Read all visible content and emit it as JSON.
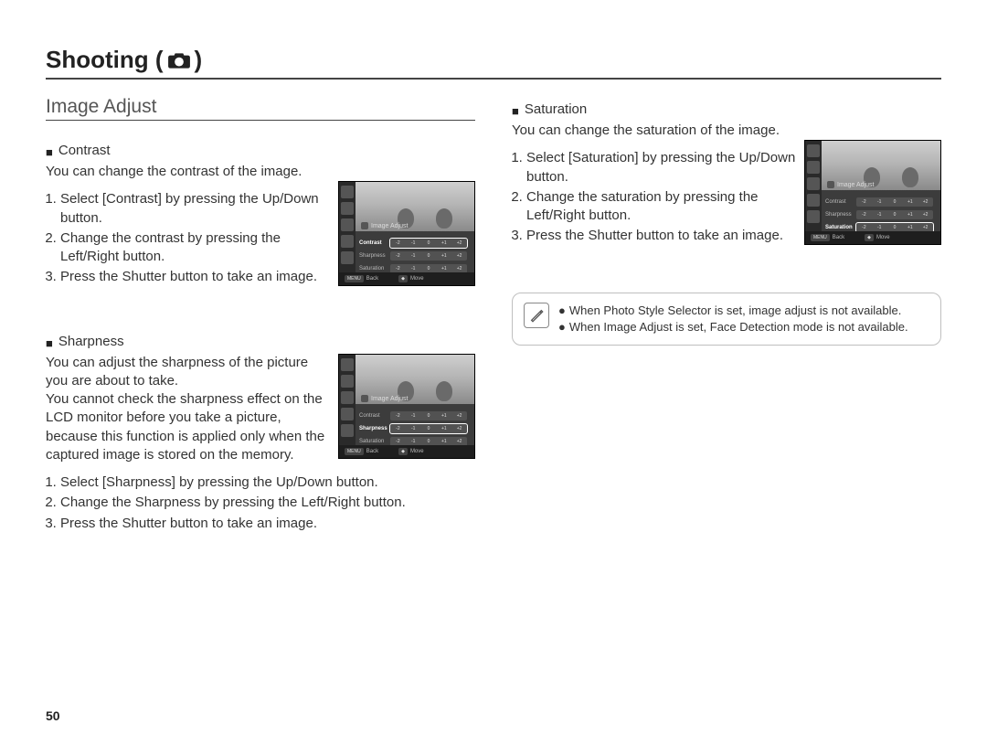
{
  "title": {
    "prefix": "Shooting (",
    "suffix": " )"
  },
  "section_title": "Image Adjust",
  "page_number": "50",
  "tick_labels": [
    "-2",
    "-1",
    "0",
    "+1",
    "+2"
  ],
  "lcd_labels": {
    "image_adjust": "Image Adjust",
    "contrast": "Contrast",
    "sharpness": "Sharpness",
    "saturation": "Saturation",
    "back_btn": "MENU",
    "back": "Back",
    "move_btn": "◆",
    "move": "Move"
  },
  "contrast": {
    "heading": "Contrast",
    "intro": "You can change the contrast of the image.",
    "steps": [
      "Select [Contrast] by pressing the Up/Down button.",
      "Change the contrast by pressing the Left/Right button.",
      "Press the Shutter button to take an image."
    ]
  },
  "sharpness": {
    "heading": "Sharpness",
    "intro": "You can adjust the sharpness of the picture you are about to take.\nYou cannot check the sharpness effect on the LCD monitor before you take a picture, because this function is applied only when the captured image is stored on the memory.",
    "steps": [
      "Select [Sharpness] by pressing the Up/Down button.",
      "Change the Sharpness by pressing the Left/Right button.",
      "Press the Shutter button to take an image."
    ]
  },
  "saturation": {
    "heading": "Saturation",
    "intro": "You can change the saturation of the image.",
    "steps": [
      "Select [Saturation] by pressing the Up/Down button.",
      "Change the saturation by pressing the Left/Right button.",
      "Press the Shutter button to take an image."
    ]
  },
  "notes": [
    "When Photo Style Selector is set, image adjust is not available.",
    "When Image Adjust is set, Face Detection mode is not available."
  ]
}
